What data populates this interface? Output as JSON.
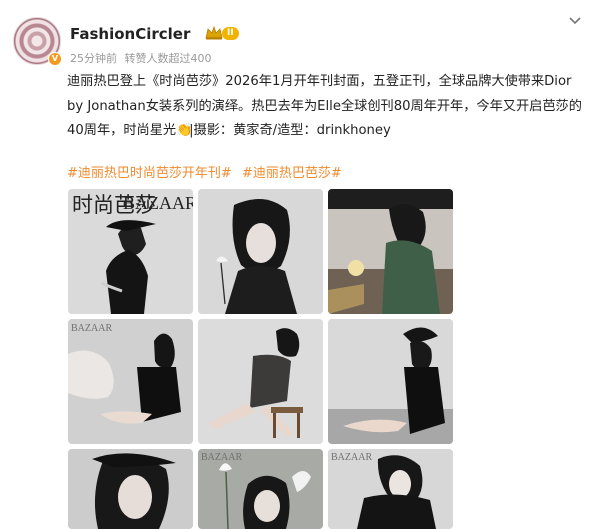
{
  "header": {
    "username": "FashionCircler",
    "level_badge": "II",
    "meta_time": "25分钟前",
    "meta_stats": "转赞人数超过400",
    "verified_badge": "V"
  },
  "post": {
    "line1": "迪丽热巴登上《时尚芭莎》2026年1月开年刊封面，五登正刊，全球品牌大使带来Dior",
    "line2": "by Jonathan女装系列的演绎。热巴去年为Elle全球创刊80周年开年，今年又开启芭莎的",
    "line3_prefix": "40周年，时尚星光",
    "line3_credit": "|摄影：黄家奇/造型：drinkhoney",
    "hashtags": [
      "#迪丽热巴时尚芭莎开年刊#",
      "#迪丽热巴芭莎#"
    ]
  },
  "images": [
    {
      "label": "时尚芭莎",
      "sub": "BAZAAR"
    },
    {
      "label": ""
    },
    {
      "label": ""
    },
    {
      "label": "BAZAAR"
    },
    {
      "label": ""
    },
    {
      "label": ""
    },
    {
      "label": ""
    },
    {
      "label": "BAZAAR"
    },
    {
      "label": "BAZAAR"
    }
  ],
  "colors": {
    "hashtag": "#f08a2d",
    "level": "#f2b300",
    "verified": "#f39a1f"
  }
}
